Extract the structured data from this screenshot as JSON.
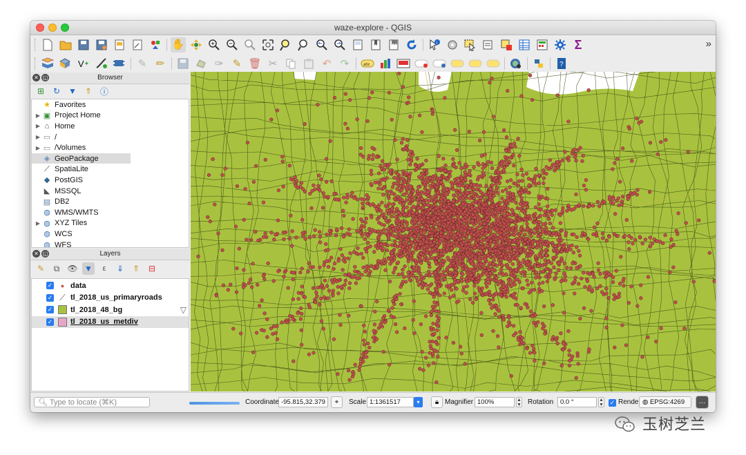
{
  "window": {
    "title": "waze-explore - QGIS"
  },
  "toolbar_more": "»",
  "panels": {
    "browser": {
      "title": "Browser",
      "items": [
        {
          "label": "Favorites",
          "icon": "star-icon",
          "arrow": false
        },
        {
          "label": "Project Home",
          "icon": "project-home-icon",
          "arrow": true
        },
        {
          "label": "Home",
          "icon": "home-icon",
          "arrow": true
        },
        {
          "label": "/",
          "icon": "folder-icon",
          "arrow": true
        },
        {
          "label": "/Volumes",
          "icon": "folder-icon",
          "arrow": true
        },
        {
          "label": "GeoPackage",
          "icon": "geopackage-icon",
          "arrow": false,
          "selected": true
        },
        {
          "label": "SpatiaLite",
          "icon": "spatialite-icon",
          "arrow": false
        },
        {
          "label": "PostGIS",
          "icon": "postgis-icon",
          "arrow": false
        },
        {
          "label": "MSSQL",
          "icon": "mssql-icon",
          "arrow": false
        },
        {
          "label": "DB2",
          "icon": "db2-icon",
          "arrow": false
        },
        {
          "label": "WMS/WMTS",
          "icon": "globe-icon",
          "arrow": false
        },
        {
          "label": "XYZ Tiles",
          "icon": "globe-icon",
          "arrow": true
        },
        {
          "label": "WCS",
          "icon": "globe-icon",
          "arrow": false
        },
        {
          "label": "WFS",
          "icon": "globe-icon",
          "arrow": false
        }
      ]
    },
    "layers": {
      "title": "Layers",
      "items": [
        {
          "name": "data",
          "checked": true,
          "symbol": "point",
          "color": "#c0504d"
        },
        {
          "name": "tl_2018_us_primaryroads",
          "checked": true,
          "symbol": "line",
          "color": "#555555"
        },
        {
          "name": "tl_2018_48_bg",
          "checked": true,
          "symbol": "fill",
          "color": "#a8c23f",
          "filtered": true
        },
        {
          "name": "tl_2018_us_metdiv",
          "checked": true,
          "symbol": "fill",
          "color": "#e9a5c7",
          "selected": true
        }
      ]
    }
  },
  "map": {
    "fill_color": "#a8c23f",
    "point_color": "#c0504d",
    "boundary_color": "#3e4a16"
  },
  "status": {
    "locate_placeholder": "Type to locate (⌘K)",
    "coordinate_label": "Coordinate",
    "coordinate_value": "-95.815,32.379",
    "scale_label": "Scale",
    "scale_value": "1:1361517",
    "magnifier_label": "Magnifier",
    "magnifier_value": "100%",
    "rotation_label": "Rotation",
    "rotation_value": "0.0 °",
    "render_label": "Render",
    "crs": "EPSG:4269"
  },
  "watermark": {
    "text": "玉树芝兰"
  }
}
